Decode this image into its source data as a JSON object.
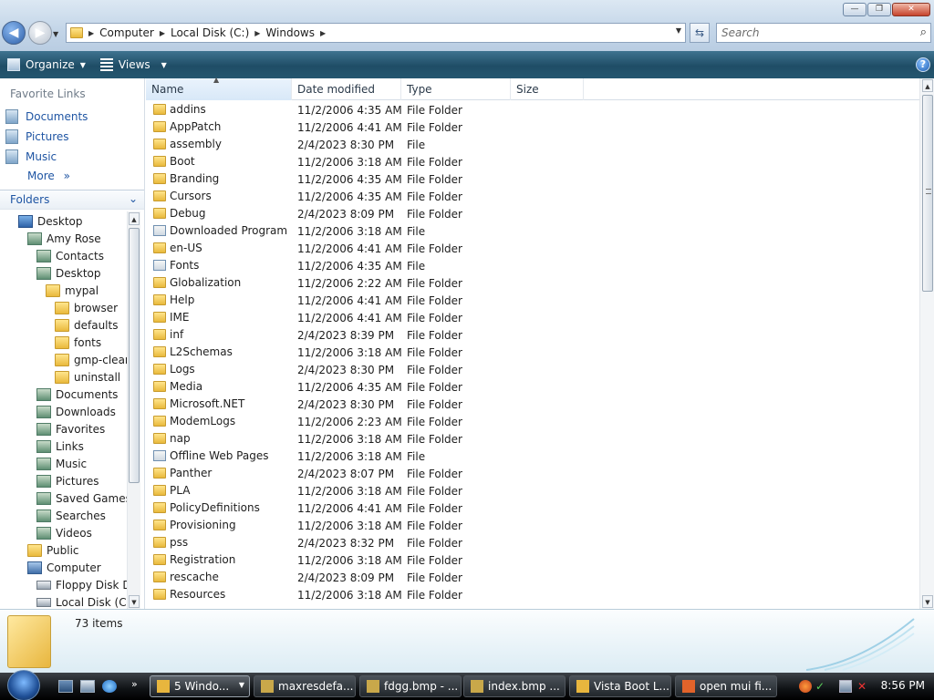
{
  "window": {
    "buttons": {
      "minimize": "—",
      "maximize": "❐",
      "close": "✕"
    }
  },
  "address": {
    "crumbs": [
      "Computer",
      "Local Disk (C:)",
      "Windows"
    ],
    "search_placeholder": "Search"
  },
  "toolbar": {
    "organize_label": "Organize",
    "views_label": "Views",
    "help_label": "?"
  },
  "nav": {
    "favorites_header": "Favorite Links",
    "favorites": [
      "Documents",
      "Pictures",
      "Music"
    ],
    "more_label": "More",
    "folders_header": "Folders",
    "tree": [
      {
        "label": "Desktop",
        "depth": 0,
        "icon": "desktop"
      },
      {
        "label": "Amy Rose",
        "depth": 1,
        "icon": "special"
      },
      {
        "label": "Contacts",
        "depth": 2,
        "icon": "special"
      },
      {
        "label": "Desktop",
        "depth": 2,
        "icon": "special"
      },
      {
        "label": "mypal",
        "depth": 3,
        "icon": "folder"
      },
      {
        "label": "browser",
        "depth": 4,
        "icon": "folder"
      },
      {
        "label": "defaults",
        "depth": 4,
        "icon": "folder"
      },
      {
        "label": "fonts",
        "depth": 4,
        "icon": "folder"
      },
      {
        "label": "gmp-clearl",
        "depth": 4,
        "icon": "folder"
      },
      {
        "label": "uninstall",
        "depth": 4,
        "icon": "folder"
      },
      {
        "label": "Documents",
        "depth": 2,
        "icon": "special"
      },
      {
        "label": "Downloads",
        "depth": 2,
        "icon": "special"
      },
      {
        "label": "Favorites",
        "depth": 2,
        "icon": "special"
      },
      {
        "label": "Links",
        "depth": 2,
        "icon": "special"
      },
      {
        "label": "Music",
        "depth": 2,
        "icon": "special"
      },
      {
        "label": "Pictures",
        "depth": 2,
        "icon": "special"
      },
      {
        "label": "Saved Games",
        "depth": 2,
        "icon": "special"
      },
      {
        "label": "Searches",
        "depth": 2,
        "icon": "special"
      },
      {
        "label": "Videos",
        "depth": 2,
        "icon": "special"
      },
      {
        "label": "Public",
        "depth": 1,
        "icon": "folder"
      },
      {
        "label": "Computer",
        "depth": 1,
        "icon": "computer"
      },
      {
        "label": "Floppy Disk Dr",
        "depth": 2,
        "icon": "drive"
      },
      {
        "label": "Local Disk (C:)",
        "depth": 2,
        "icon": "drive"
      }
    ]
  },
  "list": {
    "columns": [
      "Name",
      "Date modified",
      "Type",
      "Size"
    ],
    "rows": [
      {
        "name": "addins",
        "date": "11/2/2006 4:35 AM",
        "type": "File Folder",
        "icon": "folder"
      },
      {
        "name": "AppPatch",
        "date": "11/2/2006 4:41 AM",
        "type": "File Folder",
        "icon": "folder"
      },
      {
        "name": "assembly",
        "date": "2/4/2023 8:30 PM",
        "type": "File",
        "icon": "folder"
      },
      {
        "name": "Boot",
        "date": "11/2/2006 3:18 AM",
        "type": "File Folder",
        "icon": "folder"
      },
      {
        "name": "Branding",
        "date": "11/2/2006 4:35 AM",
        "type": "File Folder",
        "icon": "folder"
      },
      {
        "name": "Cursors",
        "date": "11/2/2006 4:35 AM",
        "type": "File Folder",
        "icon": "folder"
      },
      {
        "name": "Debug",
        "date": "2/4/2023 8:09 PM",
        "type": "File Folder",
        "icon": "folder"
      },
      {
        "name": "Downloaded Program ...",
        "date": "11/2/2006 3:18 AM",
        "type": "File",
        "icon": "special"
      },
      {
        "name": "en-US",
        "date": "11/2/2006 4:41 AM",
        "type": "File Folder",
        "icon": "folder"
      },
      {
        "name": "Fonts",
        "date": "11/2/2006 4:35 AM",
        "type": "File",
        "icon": "fonts"
      },
      {
        "name": "Globalization",
        "date": "11/2/2006 2:22 AM",
        "type": "File Folder",
        "icon": "folder"
      },
      {
        "name": "Help",
        "date": "11/2/2006 4:41 AM",
        "type": "File Folder",
        "icon": "folder"
      },
      {
        "name": "IME",
        "date": "11/2/2006 4:41 AM",
        "type": "File Folder",
        "icon": "folder"
      },
      {
        "name": "inf",
        "date": "2/4/2023 8:39 PM",
        "type": "File Folder",
        "icon": "folder"
      },
      {
        "name": "L2Schemas",
        "date": "11/2/2006 3:18 AM",
        "type": "File Folder",
        "icon": "folder"
      },
      {
        "name": "Logs",
        "date": "2/4/2023 8:30 PM",
        "type": "File Folder",
        "icon": "folder"
      },
      {
        "name": "Media",
        "date": "11/2/2006 4:35 AM",
        "type": "File Folder",
        "icon": "folder"
      },
      {
        "name": "Microsoft.NET",
        "date": "2/4/2023 8:30 PM",
        "type": "File Folder",
        "icon": "folder"
      },
      {
        "name": "ModemLogs",
        "date": "11/2/2006 2:23 AM",
        "type": "File Folder",
        "icon": "folder"
      },
      {
        "name": "nap",
        "date": "11/2/2006 3:18 AM",
        "type": "File Folder",
        "icon": "folder"
      },
      {
        "name": "Offline Web Pages",
        "date": "11/2/2006 3:18 AM",
        "type": "File",
        "icon": "special"
      },
      {
        "name": "Panther",
        "date": "2/4/2023 8:07 PM",
        "type": "File Folder",
        "icon": "folder"
      },
      {
        "name": "PLA",
        "date": "11/2/2006 3:18 AM",
        "type": "File Folder",
        "icon": "folder"
      },
      {
        "name": "PolicyDefinitions",
        "date": "11/2/2006 4:41 AM",
        "type": "File Folder",
        "icon": "folder"
      },
      {
        "name": "Provisioning",
        "date": "11/2/2006 3:18 AM",
        "type": "File Folder",
        "icon": "folder"
      },
      {
        "name": "pss",
        "date": "2/4/2023 8:32 PM",
        "type": "File Folder",
        "icon": "folder"
      },
      {
        "name": "Registration",
        "date": "11/2/2006 3:18 AM",
        "type": "File Folder",
        "icon": "folder"
      },
      {
        "name": "rescache",
        "date": "2/4/2023 8:09 PM",
        "type": "File Folder",
        "icon": "folder"
      },
      {
        "name": "Resources",
        "date": "11/2/2006 3:18 AM",
        "type": "File Folder",
        "icon": "folder"
      }
    ]
  },
  "details": {
    "count": "73 items"
  },
  "taskbar": {
    "tasks": [
      {
        "label": "5 Windo...",
        "active": true,
        "icon_color": "#e8b63e"
      },
      {
        "label": "maxresdefa...",
        "active": false,
        "icon_color": "#c9a84a"
      },
      {
        "label": "fdgg.bmp - ...",
        "active": false,
        "icon_color": "#c9a84a"
      },
      {
        "label": "index.bmp ...",
        "active": false,
        "icon_color": "#c9a84a"
      },
      {
        "label": "Vista Boot L...",
        "active": false,
        "icon_color": "#e8b63e"
      },
      {
        "label": "open mui fi...",
        "active": false,
        "icon_color": "#e2632a"
      }
    ],
    "clock": "8:56 PM"
  }
}
